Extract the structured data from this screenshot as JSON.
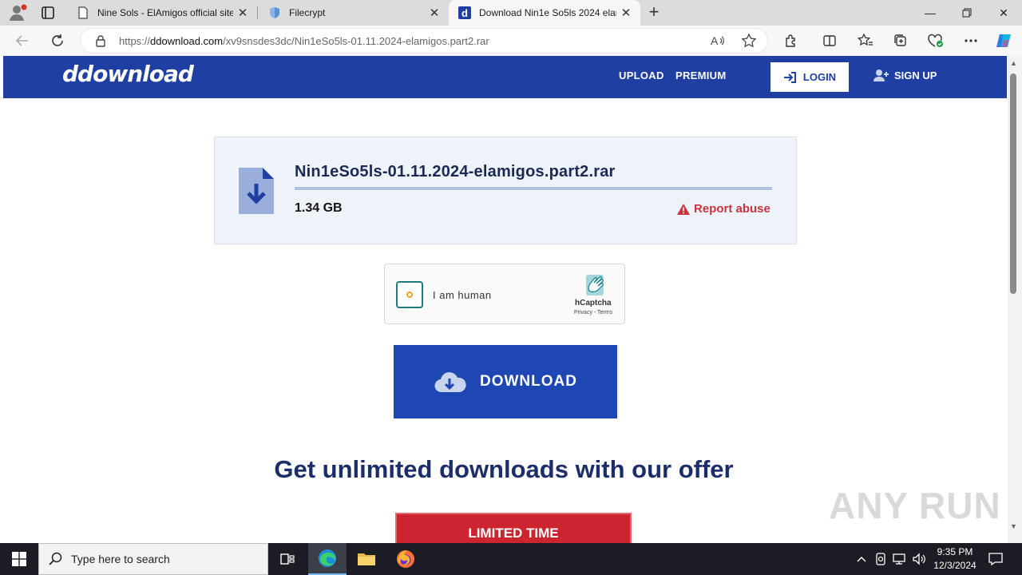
{
  "browser": {
    "tabs": [
      {
        "label": "Nine Sols - ElAmigos official site",
        "active": false
      },
      {
        "label": "Filecrypt",
        "active": false
      },
      {
        "label": "Download Nin1e So5ls 2024 elam",
        "active": true
      }
    ],
    "url_prefix": "https://",
    "url_domain": "ddownload.com",
    "url_path": "/xv9snsdes3dc/Nin1eSo5ls-01.11.2024-elamigos.part2.rar"
  },
  "site": {
    "logo": "ddownload",
    "nav": {
      "upload": "UPLOAD",
      "premium": "PREMIUM",
      "login": "LOGIN",
      "signup": "SIGN UP"
    },
    "brand_color": "#1f3fa3"
  },
  "file": {
    "name": "Nin1eSo5ls-01.11.2024-elamigos.part2.rar",
    "size": "1.34 GB",
    "report": "Report abuse"
  },
  "captcha": {
    "label": "I am human",
    "brand": "hCaptcha",
    "links": "Privacy - Terms"
  },
  "download": {
    "label": "DOWNLOAD"
  },
  "offer": {
    "headline": "Get unlimited downloads with our offer",
    "badge": "LIMITED TIME"
  },
  "watermark": "ANY RUN",
  "taskbar": {
    "search_placeholder": "Type here to search",
    "time": "9:35 PM",
    "date": "12/3/2024"
  }
}
